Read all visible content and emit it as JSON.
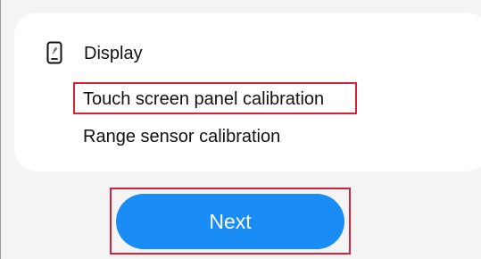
{
  "display_section": {
    "title": "Display",
    "icon": "tablet-icon",
    "items": [
      {
        "label": "Touch screen panel calibration",
        "highlighted": true
      },
      {
        "label": "Range sensor calibration",
        "highlighted": false
      }
    ]
  },
  "next_button": {
    "label": "Next",
    "highlighted": true
  },
  "colors": {
    "accent": "#1a8cf5",
    "highlight": "#d6213a",
    "card": "#ffffff",
    "background": "#f4f4f4"
  }
}
